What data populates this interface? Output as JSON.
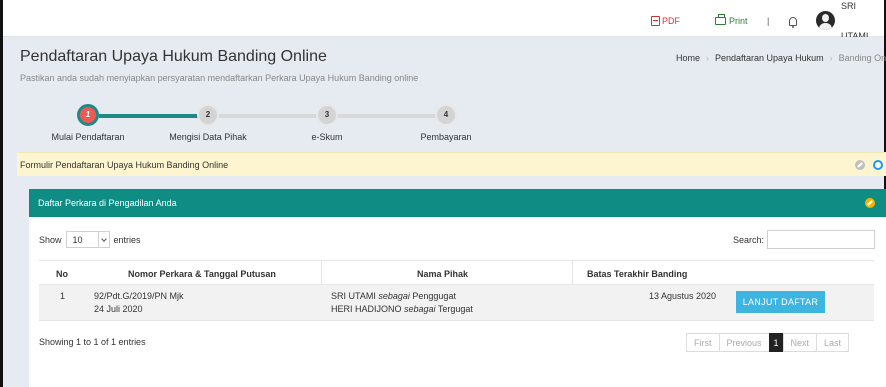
{
  "topbar": {
    "pdf_label": "PDF",
    "print_label": "Print",
    "separator": "|",
    "user_name": "SRI UTAMI",
    "icons": [
      "pdf-icon",
      "print-icon",
      "bell-icon",
      "user-avatar"
    ]
  },
  "page": {
    "title": "Pendaftaran Upaya Hukum Banding Online",
    "subtitle": "Pastikan anda sudah menyiapkan persyaratan mendaftarkan Perkara Upaya Hukum Banding online"
  },
  "breadcrumb": [
    "Home",
    "Pendaftaran Upaya Hukum",
    "Banding Onli"
  ],
  "wizard": {
    "steps": [
      {
        "num": "1",
        "label": "Mulai Pendaftaran",
        "active": true
      },
      {
        "num": "2",
        "label": "Mengisi Data Pihak",
        "active": false
      },
      {
        "num": "3",
        "label": "e-Skum",
        "active": false
      },
      {
        "num": "4",
        "label": "Pembayaran",
        "active": false
      }
    ]
  },
  "notice": {
    "text": "Formulir Pendaftaran Upaya Hukum Banding Online"
  },
  "panel": {
    "title": "Daftar Perkara di Pengadilan Anda"
  },
  "table": {
    "show_label": "Show",
    "entries_value": "10",
    "entries_label": "entries",
    "search_label": "Search:",
    "search_value": "",
    "headers": [
      "No",
      "Nomor Perkara & Tanggal Putusan",
      "Nama Pihak",
      "Batas Terakhir Banding"
    ],
    "rows": [
      {
        "no": "1",
        "nomor": "92/Pdt.G/2019/PN Mjk",
        "tanggal": "24 Juli 2020",
        "pihak1_name": "SRI UTAMI",
        "pihak1_role": "sebagai",
        "pihak1_type": "Penggugat",
        "pihak2_name": "HERI HADIJONO",
        "pihak2_role": "sebagai",
        "pihak2_type": "Tergugat",
        "batas": "13 Agustus 2020",
        "action": "LANJUT DAFTAR"
      }
    ],
    "info": "Showing 1 to 1 of 1 entries",
    "pager": {
      "first": "First",
      "previous": "Previous",
      "current": "1",
      "next": "Next",
      "last": "Last"
    }
  },
  "colors": {
    "teal": "#0f8d85",
    "active_step": "#ec5a56",
    "notice_bg": "#fcf5cf",
    "button": "#3eb4e0"
  }
}
